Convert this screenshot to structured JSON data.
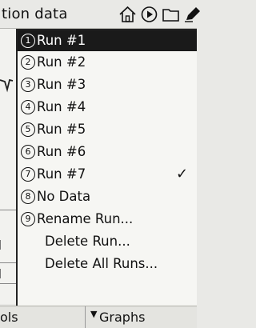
{
  "titlebar": {
    "title": "tion data",
    "icons": [
      "home-icon",
      "play-icon",
      "folder-icon",
      "pencil-icon"
    ]
  },
  "menu": {
    "items": [
      {
        "num": "1",
        "label": "Run #1",
        "selected": true,
        "checked": false
      },
      {
        "num": "2",
        "label": "Run #2",
        "selected": false,
        "checked": false
      },
      {
        "num": "3",
        "label": "Run #3",
        "selected": false,
        "checked": false
      },
      {
        "num": "4",
        "label": "Run #4",
        "selected": false,
        "checked": false
      },
      {
        "num": "5",
        "label": "Run #5",
        "selected": false,
        "checked": false
      },
      {
        "num": "6",
        "label": "Run #6",
        "selected": false,
        "checked": false
      },
      {
        "num": "7",
        "label": "Run #7",
        "selected": false,
        "checked": true
      },
      {
        "num": "8",
        "label": "No Data",
        "selected": false,
        "checked": false
      },
      {
        "num": "9",
        "label": "Rename Run...",
        "selected": false,
        "checked": false
      },
      {
        "num": "",
        "label": "Delete Run...",
        "selected": false,
        "checked": false
      },
      {
        "num": "",
        "label": "Delete All Runs...",
        "selected": false,
        "checked": false
      }
    ],
    "check_mark": "✓"
  },
  "bottombar": {
    "left_label": "ols",
    "arrow": "▼",
    "right_label": "Graphs"
  },
  "colors": {
    "selected_bg": "#1a1a1a",
    "selected_fg": "#ffffff",
    "menu_bg": "#f6f6f3",
    "bar_bg": "#e9e9e6"
  }
}
